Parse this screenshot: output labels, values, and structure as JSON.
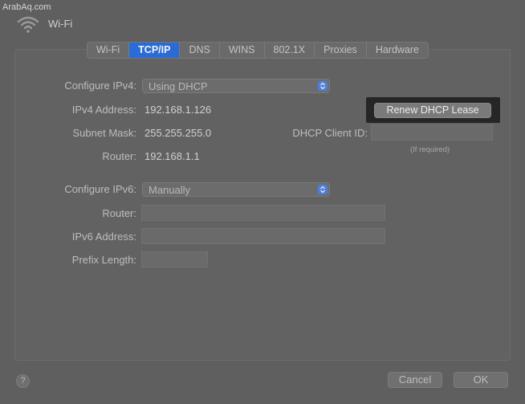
{
  "watermark": "ArabAq.com",
  "window": {
    "title": "Wi-Fi",
    "icon": "wifi-icon"
  },
  "tabs": [
    {
      "label": "Wi-Fi",
      "active": false
    },
    {
      "label": "TCP/IP",
      "active": true
    },
    {
      "label": "DNS",
      "active": false
    },
    {
      "label": "WINS",
      "active": false
    },
    {
      "label": "802.1X",
      "active": false
    },
    {
      "label": "Proxies",
      "active": false
    },
    {
      "label": "Hardware",
      "active": false
    }
  ],
  "ipv4": {
    "configure_label": "Configure IPv4:",
    "configure_value": "Using DHCP",
    "address_label": "IPv4 Address:",
    "address_value": "192.168.1.126",
    "subnet_label": "Subnet Mask:",
    "subnet_value": "255.255.255.0",
    "router_label": "Router:",
    "router_value": "192.168.1.1",
    "renew_button": "Renew DHCP Lease",
    "client_id_label": "DHCP Client ID:",
    "client_id_value": "",
    "client_id_hint": "(If required)"
  },
  "ipv6": {
    "configure_label": "Configure IPv6:",
    "configure_value": "Manually",
    "router_label": "Router:",
    "router_value": "",
    "address_label": "IPv6 Address:",
    "address_value": "",
    "prefix_label": "Prefix Length:",
    "prefix_value": ""
  },
  "footer": {
    "help_label": "?",
    "cancel_label": "Cancel",
    "ok_label": "OK"
  },
  "colors": {
    "overlay_bg": "#5f5f5f",
    "accent": "#2a6bd8",
    "highlight_frame": "#262626"
  }
}
